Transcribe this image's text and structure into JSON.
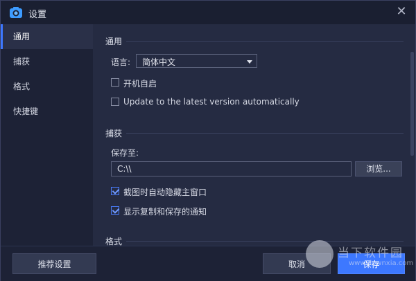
{
  "window": {
    "title": "设置"
  },
  "sidebar": {
    "items": [
      {
        "label": "通用",
        "active": true
      },
      {
        "label": "捕获",
        "active": false
      },
      {
        "label": "格式",
        "active": false
      },
      {
        "label": "快捷键",
        "active": false
      }
    ]
  },
  "general": {
    "heading": "通用",
    "language_label": "语言:",
    "language_value": "简体中文",
    "startup_label": "开机自启",
    "startup_checked": false,
    "update_label": "Update to the latest version automatically",
    "update_checked": false
  },
  "capture": {
    "heading": "捕获",
    "save_to_label": "保存至:",
    "save_path": "C:\\\\",
    "browse_label": "浏览...",
    "hide_window_label": "截图时自动隐藏主窗口",
    "hide_window_checked": true,
    "notify_label": "显示复制和保存的通知",
    "notify_checked": true
  },
  "format": {
    "heading": "格式"
  },
  "footer": {
    "recommended_label": "推荐设置",
    "cancel_label": "取消",
    "save_label": "保存"
  },
  "watermark": {
    "text": "当下软件园",
    "sub": "www.downxia.com"
  },
  "colors": {
    "accent": "#3d78ff",
    "background": "#1d2236",
    "panel": "#252b42"
  }
}
